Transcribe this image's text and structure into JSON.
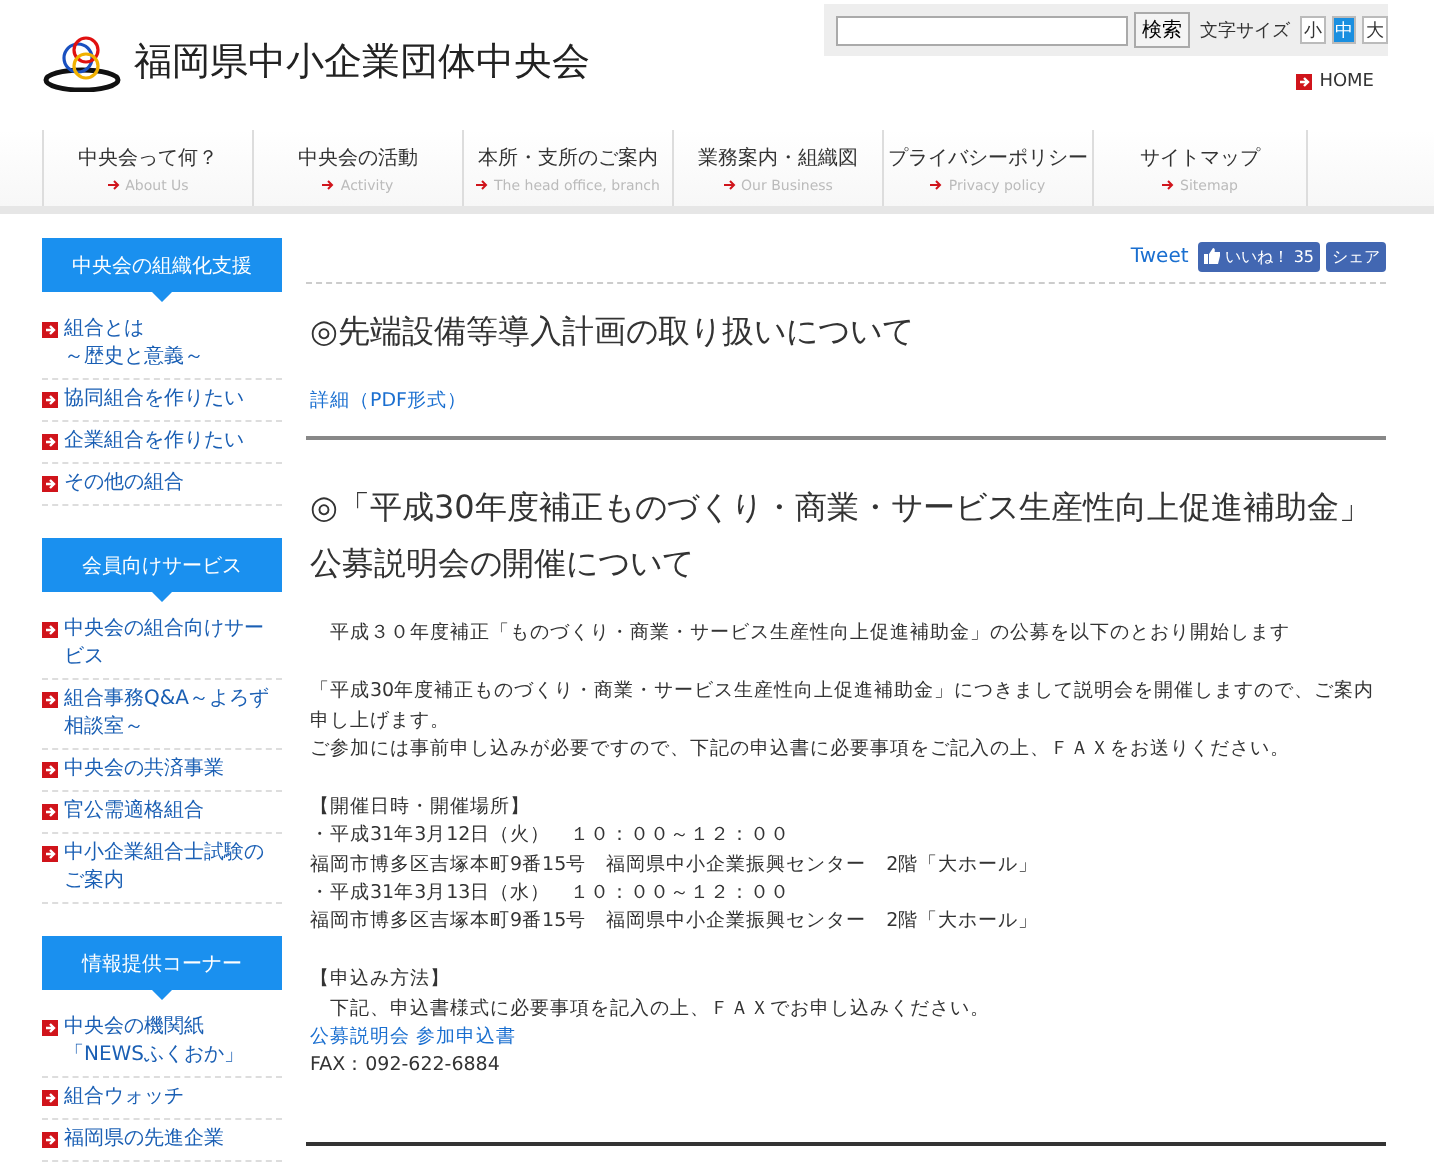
{
  "header": {
    "site_title": "福岡県中小企業団体中央会",
    "search": {
      "button": "検索"
    },
    "font_size": {
      "label": "文字サイズ",
      "options": [
        {
          "label": "小",
          "selected": false
        },
        {
          "label": "中",
          "selected": true
        },
        {
          "label": "大",
          "selected": false
        }
      ]
    },
    "home_link": "HOME"
  },
  "nav": [
    {
      "label": "中央会って何？",
      "sub": "About Us"
    },
    {
      "label": "中央会の活動",
      "sub": "Activity"
    },
    {
      "label": "本所・支所のご案内",
      "sub": "The head office, branch"
    },
    {
      "label": "業務案内・組織図",
      "sub": "Our Business"
    },
    {
      "label": "プライバシーポリシー",
      "sub": "Privacy policy"
    },
    {
      "label": "サイトマップ",
      "sub": "Sitemap"
    }
  ],
  "sidebar": [
    {
      "heading": "中央会の組織化支援",
      "items": [
        [
          "組合とは",
          "～歴史と意義～"
        ],
        [
          "協同組合を作りたい"
        ],
        [
          "企業組合を作りたい"
        ],
        [
          "その他の組合"
        ]
      ]
    },
    {
      "heading": "会員向けサービス",
      "items": [
        [
          "中央会の組合向けサービス"
        ],
        [
          "組合事務Q&A～よろず相談室～"
        ],
        [
          "中央会の共済事業"
        ],
        [
          "官公需適格組合"
        ],
        [
          "中小企業組合士試験のご案内"
        ]
      ]
    },
    {
      "heading": "情報提供コーナー",
      "items": [
        [
          "中央会の機関紙",
          "「NEWSふくおか」"
        ],
        [
          "組合ウォッチ"
        ],
        [
          "福岡県の先進企業"
        ]
      ]
    }
  ],
  "social": {
    "tweet": "Tweet",
    "like": "いいね！",
    "like_count": "35",
    "share": "シェア"
  },
  "articles": [
    {
      "title": "◎先端設備等導入計画の取り扱いについて",
      "body": [
        {
          "kind": "link",
          "text": "詳細（PDF形式）"
        }
      ]
    },
    {
      "title": "◎「平成30年度補正ものづくり・商業・サービス生産性向上促進補助金」公募説明会の開催について",
      "body": [
        {
          "kind": "text",
          "text": "　平成３０年度補正「ものづくり・商業・サービス生産性向上促進補助金」の公募を以下のとおり開始します"
        },
        {
          "kind": "gap"
        },
        {
          "kind": "text",
          "text": "「平成30年度補正ものづくり・商業・サービス生産性向上促進補助金」につきまして説明会を開催しますので、ご案内申し上げます。"
        },
        {
          "kind": "text",
          "text": "ご参加には事前申し込みが必要ですので、下記の申込書に必要事項をご記入の上、ＦＡＸをお送りください。"
        },
        {
          "kind": "gap"
        },
        {
          "kind": "text",
          "text": "【開催日時・開催場所】"
        },
        {
          "kind": "text",
          "text": "・平成31年3月12日（火）　１０：００～１２：００"
        },
        {
          "kind": "text",
          "text": "福岡市博多区吉塚本町9番15号　福岡県中小企業振興センター　2階「大ホール」"
        },
        {
          "kind": "text",
          "text": "・平成31年3月13日（水）　１０：００～１２：００"
        },
        {
          "kind": "text",
          "text": "福岡市博多区吉塚本町9番15号　福岡県中小企業振興センター　2階「大ホール」"
        },
        {
          "kind": "gap"
        },
        {
          "kind": "text",
          "text": "【申込み方法】"
        },
        {
          "kind": "text",
          "text": "　下記、申込書様式に必要事項を記入の上、ＦＡＸでお申し込みください。"
        },
        {
          "kind": "link",
          "text": "公募説明会 参加申込書"
        },
        {
          "kind": "text",
          "text": "FAX：092-622-6884"
        }
      ]
    }
  ]
}
